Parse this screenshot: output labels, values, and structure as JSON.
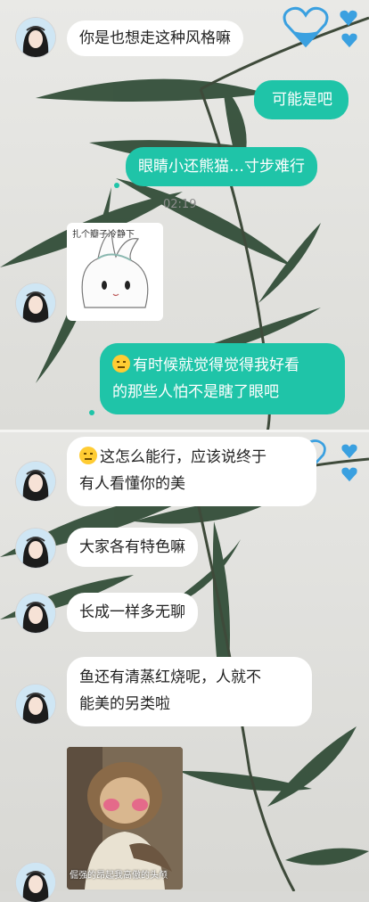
{
  "timestamp": "02:19",
  "messages": [
    {
      "text": "你是也想走这种风格嘛"
    },
    {
      "text": "可能是吧"
    },
    {
      "text": "眼睛小还熊猫…寸步难行"
    },
    {
      "line1": "有时候就觉得觉得我好看",
      "line2": "的那些人怕不是瞎了眼吧"
    },
    {
      "line1": "这怎么能行，应该说终于",
      "line2": "有人看懂你的美"
    },
    {
      "text": "大家各有特色嘛"
    },
    {
      "text": "长成一样多无聊"
    },
    {
      "line1": "鱼还有清蒸红烧呢，人就不",
      "line2": "能美的另类啦"
    }
  ],
  "stickers": {
    "cat_caption": "扎个瓣子冷静下",
    "photo_caption": "倔强的昂起我高傲的头颅"
  },
  "colors": {
    "outgoing_bubble": "#1fc4a8",
    "incoming_bubble": "#ffffff",
    "heart": "#3aa0e0"
  }
}
